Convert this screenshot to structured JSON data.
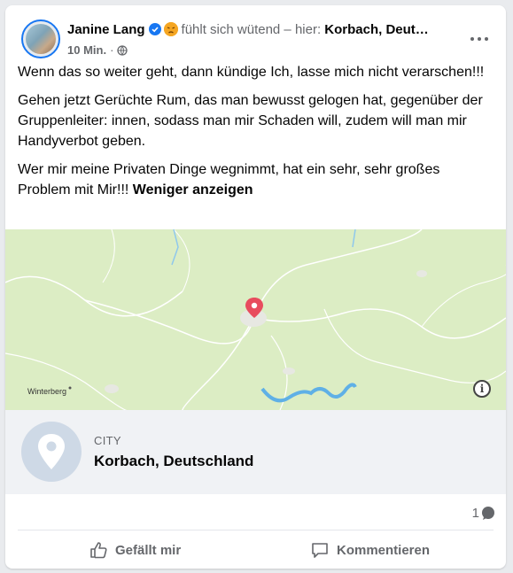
{
  "post": {
    "author": "Janine Lang",
    "feeling": "fühlt sich wütend – hier:",
    "location_short": "Korbach, Deut…",
    "time": "10 Min.",
    "paragraphs": [
      "Wenn das so weiter geht, dann kündige Ich, lasse mich nicht verarschen!!!",
      "Gehen jetzt Gerüchte Rum, das man bewusst gelogen hat, gegenüber der Gruppenleiter: innen, sodass man mir Schaden will, zudem will man mir Handyverbot geben.",
      "Wer mir meine Privaten Dinge wegnimmt, hat ein sehr, sehr großes Problem mit Mir!!!"
    ],
    "show_less": "Weniger anzeigen"
  },
  "map": {
    "label": "Winterberg",
    "info": "i"
  },
  "place": {
    "category": "CITY",
    "name": "Korbach, Deutschland"
  },
  "counts": {
    "comments": "1"
  },
  "actions": {
    "like": "Gefällt mir",
    "comment": "Kommentieren"
  },
  "icons": {
    "verified": "verified-badge-icon",
    "feeling": "angry-face-icon",
    "privacy": "globe-icon",
    "more": "more-options-icon",
    "pin": "map-pin-icon",
    "place": "location-pin-icon",
    "comment_count": "comment-bubble-icon",
    "like": "thumbs-up-icon",
    "comment": "comment-icon"
  },
  "colors": {
    "accent": "#1877f2",
    "map_pin": "#e84c5e",
    "map_land": "#dcedc4",
    "water": "#8fc8ec"
  }
}
